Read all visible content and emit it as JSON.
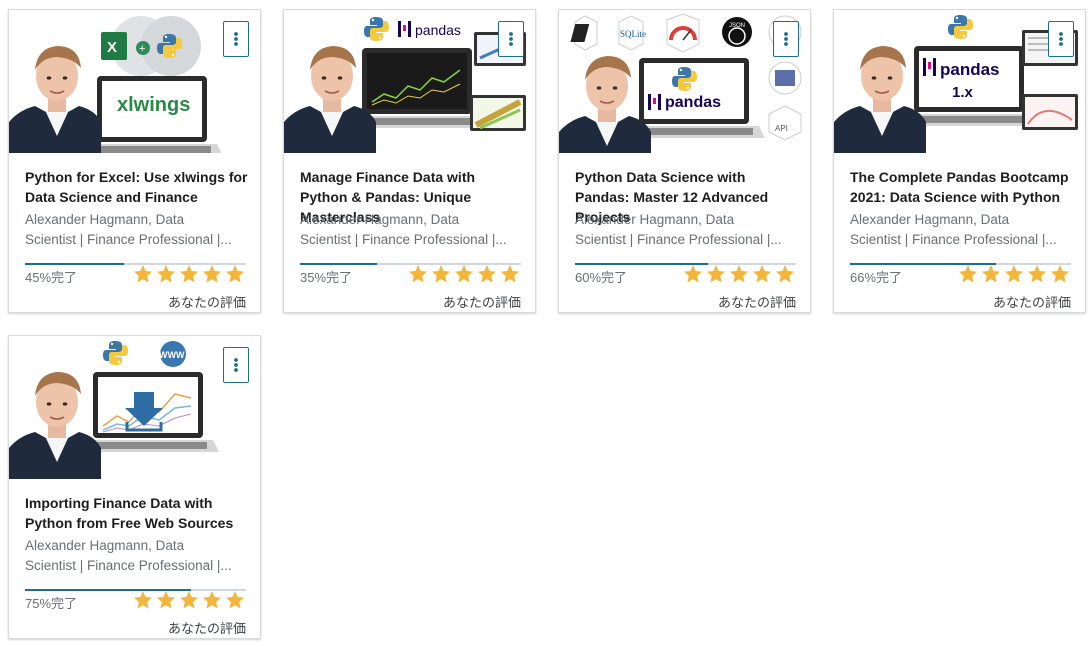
{
  "menu_icon": "vertical-dots-icon",
  "star_color": "#f3b63a",
  "progress_color": "#1c6e91",
  "cards": [
    {
      "title": "Python for Excel: Use xlwings for Data Science and Finance",
      "author_line1": "Alexander Hagmann, Data",
      "author_line2": "Scientist | Finance Professional |...",
      "progress": 45,
      "progress_label": "45%完了",
      "rating_stars": 5,
      "rating_label": "あなたの評価",
      "thumb_text": "xlwings",
      "thumb_logos": [
        "X",
        "+"
      ]
    },
    {
      "title": "Manage Finance Data with Python & Pandas: Unique Masterclass",
      "author_line1": "Alexander Hagmann, Data",
      "author_line2": "Scientist | Finance Professional |...",
      "progress": 35,
      "progress_label": "35%完了",
      "rating_stars": 5,
      "rating_label": "あなたの評価",
      "thumb_text": "pandas"
    },
    {
      "title": "Python Data Science with Pandas: Master 12 Advanced Projects",
      "author_line1": "Alexander Hagmann, Data",
      "author_line2": "Scientist | Finance Professional |...",
      "progress": 60,
      "progress_label": "60%完了",
      "rating_stars": 5,
      "rating_label": "あなたの評価",
      "thumb_text": "pandas",
      "thumb_logos": [
        "SQLite",
        "JSON",
        "API"
      ]
    },
    {
      "title": "The Complete Pandas Bootcamp 2021: Data Science with Python",
      "author_line1": "Alexander Hagmann, Data",
      "author_line2": "Scientist | Finance Professional |...",
      "progress": 66,
      "progress_label": "66%完了",
      "rating_stars": 5,
      "rating_label": "あなたの評価",
      "thumb_text": "pandas",
      "thumb_subtext": "1.x"
    },
    {
      "title": "Importing Finance Data with Python from Free Web Sources",
      "author_line1": "Alexander Hagmann, Data",
      "author_line2": "Scientist | Finance Professional |...",
      "progress": 75,
      "progress_label": "75%完了",
      "rating_stars": 5,
      "rating_label": "あなたの評価",
      "thumb_logos": [
        "WWW"
      ]
    }
  ]
}
